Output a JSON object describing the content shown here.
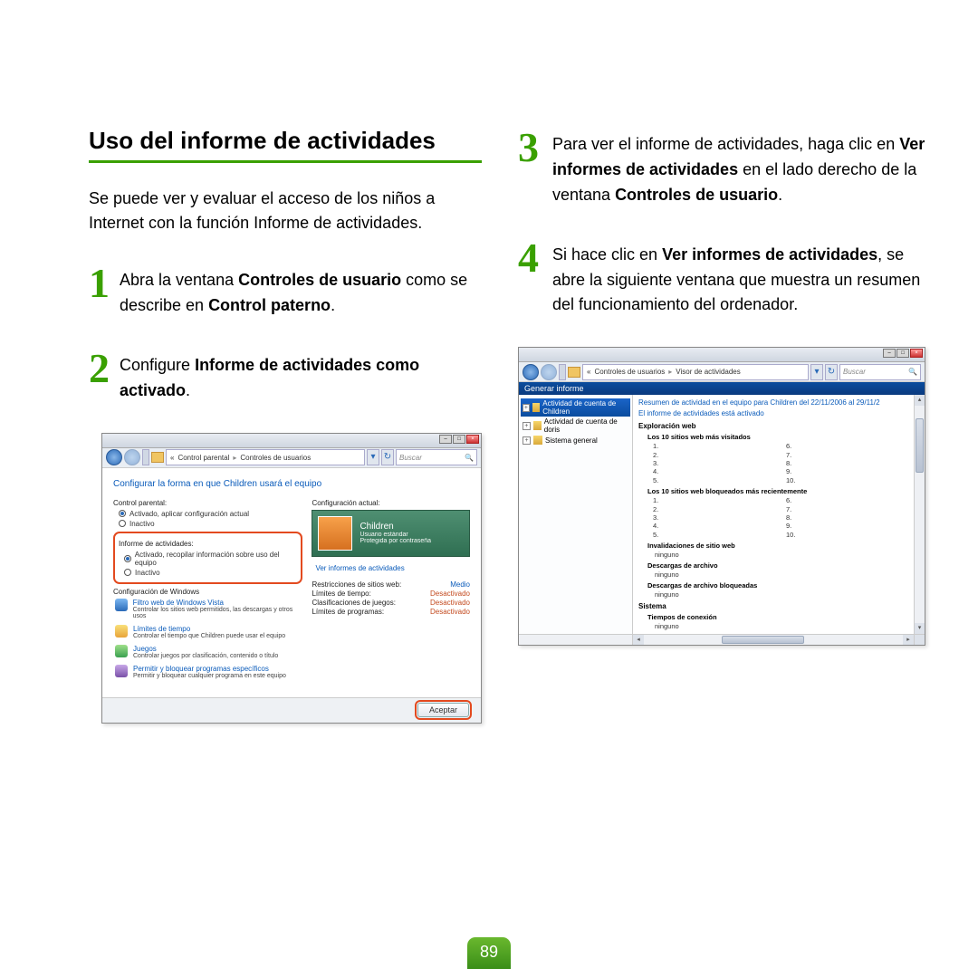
{
  "page_number": "89",
  "heading": "Uso del informe de actividades",
  "intro": "Se puede ver y evaluar el acceso de los niños a Internet con la función Informe de actividades.",
  "steps": {
    "s1": {
      "n": "1",
      "pre": "Abra la ventana ",
      "b1": "Controles de usuario",
      "mid": " como se describe en ",
      "b2": "Control paterno",
      "post": "."
    },
    "s2": {
      "n": "2",
      "pre": "Configure ",
      "b1": "Informe de actividades como activado",
      "post": "."
    },
    "s3": {
      "n": "3",
      "pre": "Para ver el informe de actividades, haga clic en ",
      "b1": "Ver informes de actividades",
      "mid": " en el lado derecho de la ventana ",
      "b2": "Controles de usuario",
      "post": "."
    },
    "s4": {
      "n": "4",
      "pre": "Si hace clic en ",
      "b1": "Ver informes de actividades",
      "post": ", se abre la siguiente ventana que muestra un resumen del funcionamiento del ordenador."
    }
  },
  "win1": {
    "breadcrumb_a": "Control parental",
    "breadcrumb_b": "Controles de usuarios",
    "search_ph": "Buscar",
    "headline": "Configurar la forma en que Children usará el equipo",
    "left": {
      "cp_label": "Control parental:",
      "r1": "Activado, aplicar configuración actual",
      "r2": "Inactivo",
      "ia_label": "Informe de actividades:",
      "ia1": "Activado, recopilar información sobre uso del equipo",
      "ia2": "Inactivo",
      "cw_label": "Configuración de Windows",
      "it1_link": "Filtro web de Windows Vista",
      "it1_desc": "Controlar los sitios web permitidos, las descargas y otros usos",
      "it2_link": "Límites de tiempo",
      "it2_desc": "Controlar el tiempo que Children puede usar el equipo",
      "it3_link": "Juegos",
      "it3_desc": "Controlar juegos por clasificación, contenido o título",
      "it4_link": "Permitir y bloquear programas específicos",
      "it4_desc": "Permitir y bloquear cualquier programa en este equipo"
    },
    "right": {
      "ca_label": "Configuración actual:",
      "user_name": "Children",
      "user_type": "Usuario estándar",
      "user_prot": "Protegida por contraseña",
      "view_link": "Ver informes de actividades",
      "rows_lbl_1": "Restricciones de sitios web:",
      "rows_val_1": "Medio",
      "rows_lbl_2": "Límites de tiempo:",
      "rows_val_2": "Desactivado",
      "rows_lbl_3": "Clasificaciones de juegos:",
      "rows_val_3": "Desactivado",
      "rows_lbl_4": "Límites de programas:",
      "rows_val_4": "Desactivado"
    },
    "ok": "Aceptar"
  },
  "win2": {
    "breadcrumb_a": "Controles de usuarios",
    "breadcrumb_b": "Visor de actividades",
    "search_ph": "Buscar",
    "toolbar": "Generar informe",
    "tree": {
      "t1": "Actividad de cuenta de Children",
      "t2": "Actividad de cuenta de doris",
      "t3": "Sistema general"
    },
    "summary": "Resumen de actividad en el equipo para Children del 22/11/2006 al 29/11/2",
    "status": "El informe de actividades está activado",
    "sec_web": "Exploración web",
    "sub_visited": "Los 10 sitios web más visitados",
    "sub_blocked": "Los 10 sitios web bloqueados más recientemente",
    "sub_overrides": "Invalidaciones de sitio web",
    "sub_dl": "Descargas de archivo",
    "sub_dlb": "Descargas de archivo bloqueadas",
    "sec_sys": "Sistema",
    "sub_conn": "Tiempos de conexión",
    "none": "ninguno",
    "n1": "1.",
    "n2": "2.",
    "n3": "3.",
    "n4": "4.",
    "n5": "5.",
    "n6": "6.",
    "n7": "7.",
    "n8": "8.",
    "n9": "9.",
    "n10": "10."
  }
}
